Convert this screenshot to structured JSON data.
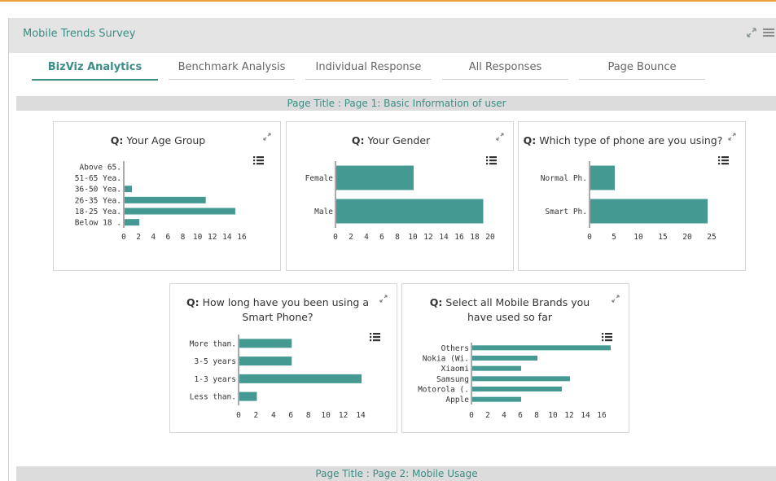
{
  "app": {
    "title": "Mobile Trends Survey",
    "accent": "#3a8e85",
    "bar_color": "#449a92"
  },
  "header": {
    "icons": [
      "expand-icon",
      "hamburger-menu-icon"
    ]
  },
  "tabs": [
    {
      "label": "BizViz Analytics",
      "active": true
    },
    {
      "label": "Benchmark Analysis",
      "active": false
    },
    {
      "label": "Individual Response",
      "active": false
    },
    {
      "label": "All Responses",
      "active": false
    },
    {
      "label": "Page Bounce",
      "active": false
    }
  ],
  "pages": [
    {
      "title": "Page Title : Page 1: Basic Information of user"
    },
    {
      "title": "Page Title : Page 2: Mobile Usage"
    }
  ],
  "chart_data": [
    {
      "type": "bar",
      "orientation": "horizontal",
      "q_prefix": "Q:",
      "title": "Your Age Group",
      "categories": [
        "Above 65.",
        "51-65 Yea.",
        "36-50 Yea.",
        "26-35 Yea.",
        "18-25 Yea.",
        "Below 18 ."
      ],
      "values": [
        0,
        0,
        1,
        11,
        15,
        2
      ],
      "xticks": [
        "0",
        "2",
        "4",
        "6",
        "8",
        "10",
        "12",
        "14",
        "16"
      ],
      "xlim": [
        0,
        16
      ]
    },
    {
      "type": "bar",
      "orientation": "horizontal",
      "q_prefix": "Q:",
      "title": "Your Gender",
      "categories": [
        "Female",
        "Male"
      ],
      "values": [
        10,
        19
      ],
      "xticks": [
        "0",
        "2",
        "4",
        "6",
        "8",
        "10",
        "12",
        "14",
        "16",
        "18",
        "20"
      ],
      "xlim": [
        0,
        20
      ]
    },
    {
      "type": "bar",
      "orientation": "horizontal",
      "q_prefix": "Q:",
      "title": "Which type of phone are you using?",
      "categories": [
        "Normal Ph.",
        "Smart Ph."
      ],
      "values": [
        5,
        24
      ],
      "xticks": [
        "0",
        "5",
        "10",
        "15",
        "20",
        "25"
      ],
      "xlim": [
        0,
        25
      ]
    },
    {
      "type": "bar",
      "orientation": "horizontal",
      "q_prefix": "Q:",
      "title": "How long have you been using a Smart Phone?",
      "categories": [
        "More than.",
        "3-5 years",
        "1-3 years",
        "Less than."
      ],
      "values": [
        6,
        6,
        14,
        2
      ],
      "xticks": [
        "0",
        "2",
        "4",
        "6",
        "8",
        "10",
        "12",
        "14"
      ],
      "xlim": [
        0,
        14
      ]
    },
    {
      "type": "bar",
      "orientation": "horizontal",
      "q_prefix": "Q:",
      "title": "Select all Mobile Brands you have used so far",
      "categories": [
        "Others",
        "Nokia (Wi.",
        "Xiaomi",
        "Samsung",
        "Motorola (.",
        "Apple"
      ],
      "values": [
        17,
        8,
        6,
        12,
        11,
        6
      ],
      "xticks": [
        "0",
        "2",
        "4",
        "6",
        "8",
        "10",
        "12",
        "14",
        "16"
      ],
      "xlim": [
        0,
        16
      ]
    }
  ]
}
